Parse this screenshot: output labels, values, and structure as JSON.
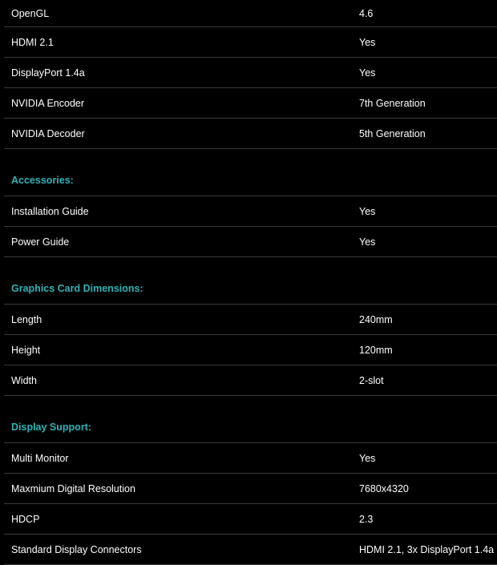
{
  "colors": {
    "background": "#000000",
    "text": "#ffffff",
    "section_heading": "#2ab3b8",
    "divider": "#3a3a3a"
  },
  "top_rows": [
    {
      "label": "OpenGL",
      "value": "4.6"
    },
    {
      "label": "HDMI 2.1",
      "value": "Yes"
    },
    {
      "label": "DisplayPort 1.4a",
      "value": "Yes"
    },
    {
      "label": "NVIDIA Encoder",
      "value": "7th Generation"
    },
    {
      "label": "NVIDIA Decoder",
      "value": "5th Generation"
    }
  ],
  "sections": [
    {
      "title": "Accessories:",
      "rows": [
        {
          "label": "Installation Guide",
          "value": "Yes"
        },
        {
          "label": "Power Guide",
          "value": "Yes"
        }
      ]
    },
    {
      "title": "Graphics Card Dimensions:",
      "rows": [
        {
          "label": "Length",
          "value": "240mm"
        },
        {
          "label": "Height",
          "value": "120mm"
        },
        {
          "label": "Width",
          "value": "2-slot"
        }
      ]
    },
    {
      "title": "Display Support:",
      "rows": [
        {
          "label": "Multi Monitor",
          "value": "Yes"
        },
        {
          "label": "Maxmium Digital Resolution",
          "value": "7680x4320"
        },
        {
          "label": "HDCP",
          "value": "2.3"
        },
        {
          "label": "Standard Display Connectors",
          "value": "HDMI 2.1, 3x DisplayPort 1.4a"
        }
      ]
    }
  ]
}
